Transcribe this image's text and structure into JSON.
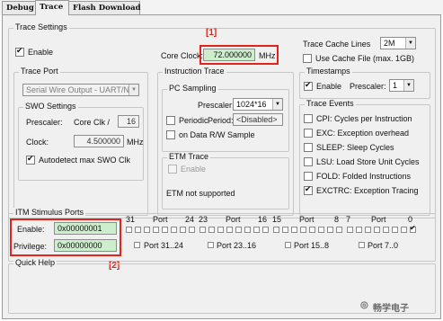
{
  "tabs": [
    {
      "label": "Debug"
    },
    {
      "label": "Trace"
    },
    {
      "label": "Flash Download"
    }
  ],
  "trace_settings": {
    "title": "Trace Settings",
    "enable_label": "Enable",
    "core_clock_label": "Core Clock:",
    "core_clock_value": "72.000000",
    "core_clock_unit": "MHz",
    "cache_lines_label": "Trace Cache Lines",
    "cache_lines_value": "2M",
    "use_cache_file_label": "Use Cache File (max. 1GB)"
  },
  "trace_port": {
    "title": "Trace Port",
    "selected": "Serial Wire Output - UART/N"
  },
  "swo_settings": {
    "title": "SWO Settings",
    "prescaler_label": "Prescaler:",
    "core_clk_label": "Core Clk /",
    "prescaler_value": "16",
    "clock_label": "Clock:",
    "clock_value": "4.500000",
    "clock_unit": "MHz",
    "autodetect_label": "Autodetect max SWO Clk"
  },
  "timestamps": {
    "title": "Timestamps",
    "enable_label": "Enable",
    "prescaler_label": "Prescaler:",
    "prescaler_value": "1"
  },
  "instruction_trace": {
    "title": "Instruction Trace",
    "pc_sampling_title": "PC Sampling",
    "prescaler_label": "Prescaler:",
    "prescaler_value": "1024*16",
    "periodic_label": "Periodic",
    "period_label": "Period:",
    "period_value": "<Disabled>",
    "data_rw_label": "on Data R/W Sample",
    "etm_title": "ETM Trace",
    "etm_enable_label": "Enable",
    "etm_status": "ETM not supported"
  },
  "trace_events": {
    "title": "Trace Events",
    "items": [
      {
        "label": "CPI: Cycles per Instruction",
        "checked": false
      },
      {
        "label": "EXC: Exception overhead",
        "checked": false
      },
      {
        "label": "SLEEP: Sleep Cycles",
        "checked": false
      },
      {
        "label": "LSU: Load Store Unit Cycles",
        "checked": false
      },
      {
        "label": "FOLD: Folded Instructions",
        "checked": false
      },
      {
        "label": "EXCTRC: Exception Tracing",
        "checked": true
      }
    ]
  },
  "itm": {
    "title": "ITM Stimulus Ports",
    "enable_label": "Enable:",
    "enable_value": "0x00000001",
    "privilege_label": "Privilege:",
    "privilege_value": "0x00000000",
    "header_numbers": [
      "31",
      "24",
      "23",
      "16",
      "15",
      "8",
      "7",
      "0"
    ],
    "port_word": "Port",
    "privilege_groups": [
      "Port 31..24",
      "Port 23..16",
      "Port 15..8",
      "Port 7..0"
    ],
    "enabled_bits": [
      0
    ]
  },
  "quick_help": {
    "title": "Quick Help"
  },
  "annotations": {
    "mark1": "[1]",
    "mark2": "[2]",
    "color": "#e1251b"
  },
  "watermark": "畅学电子"
}
